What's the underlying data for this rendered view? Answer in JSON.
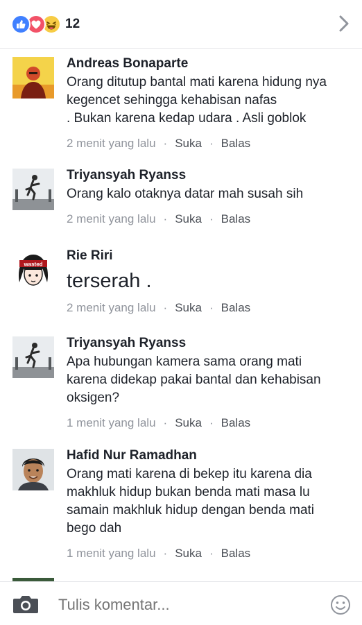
{
  "header": {
    "reactions": [
      "like-icon",
      "love-icon",
      "haha-icon"
    ],
    "reaction_count": "12",
    "next_icon": "chevron-right-icon"
  },
  "comments": [
    {
      "author": "Andreas Bonaparte",
      "lines": [
        "Orang ditutup bantal mati karena hidung nya",
        "kegencet sehingga kehabisan nafas",
        ". Bukan karena kedap udara . Asli goblok"
      ],
      "time": "2 menit yang lalu",
      "like": "Suka",
      "reply": "Balas"
    },
    {
      "author": "Triyansyah Ryanss",
      "lines": [
        "Orang kalo otaknya datar mah susah sih"
      ],
      "time": "2 menit yang lalu",
      "like": "Suka",
      "reply": "Balas"
    },
    {
      "author": "Rie Riri",
      "lines": [
        "terserah ."
      ],
      "time": "2 menit yang lalu",
      "like": "Suka",
      "reply": "Balas"
    },
    {
      "author": "Triyansyah Ryanss",
      "lines": [
        "Apa hubungan kamera sama orang mati",
        "karena didekap pakai bantal dan kehabisan",
        "oksigen?"
      ],
      "time": "1 menit yang lalu",
      "like": "Suka",
      "reply": "Balas"
    },
    {
      "author": "Hafid Nur Ramadhan",
      "lines": [
        "Orang mati karena di bekep itu karena dia",
        "makhluk hidup bukan benda mati masa lu",
        "samain makhluk hidup dengan benda mati",
        "bego dah"
      ],
      "time": "1 menit yang lalu",
      "like": "Suka",
      "reply": "Balas"
    }
  ],
  "avatar3_text": "wasted",
  "composer": {
    "placeholder": "Tulis komentar...",
    "camera_icon": "camera-icon",
    "emoji_icon": "smiley-icon"
  }
}
